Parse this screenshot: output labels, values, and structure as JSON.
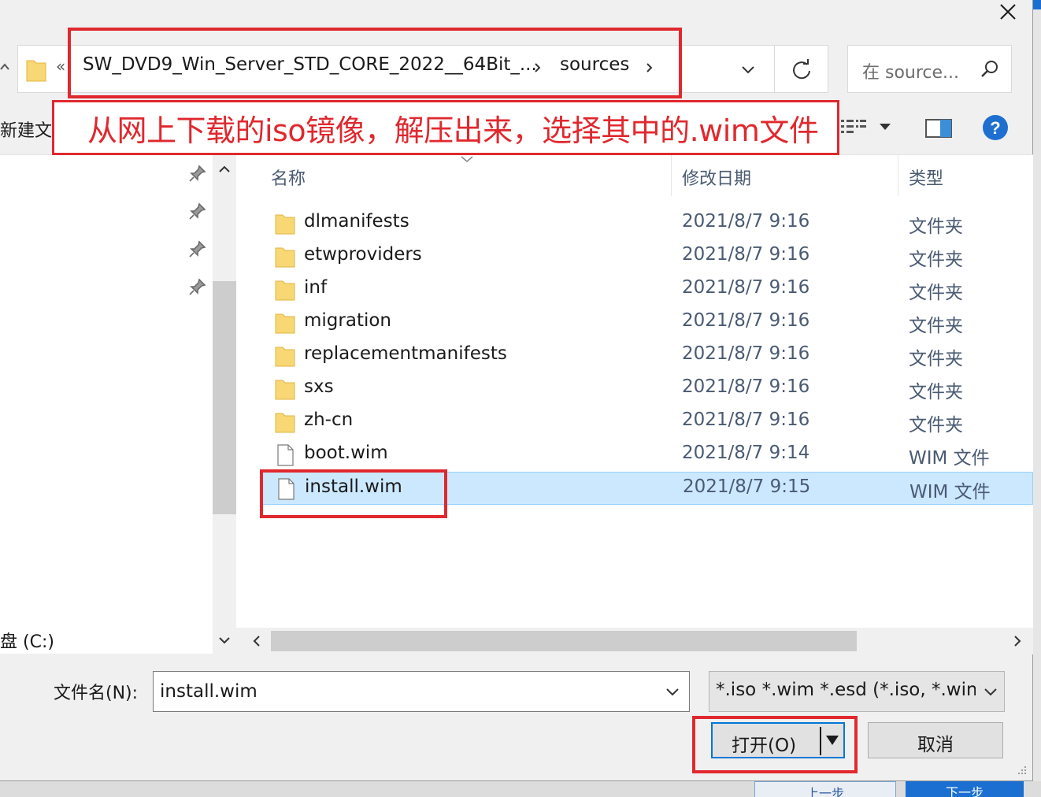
{
  "address_bar": {
    "overflow_label": "«",
    "segments": [
      "SW_DVD9_Win_Server_STD_CORE_2022__64Bit_...",
      "sources"
    ]
  },
  "search": {
    "placeholder": "在 source..."
  },
  "toolbar": {
    "new_folder_label": "新建文件夹"
  },
  "annotation": {
    "caption": "从网上下载的iso镜像，解压出来，选择其中的.wim文件"
  },
  "nav_pane": {
    "drive_label": "盘 (C:)"
  },
  "columns": {
    "name": "名称",
    "date_modified": "修改日期",
    "type": "类型"
  },
  "files": [
    {
      "name": "dlmanifests",
      "date": "2021/8/7 9:16",
      "type": "文件夹",
      "kind": "folder"
    },
    {
      "name": "etwproviders",
      "date": "2021/8/7 9:16",
      "type": "文件夹",
      "kind": "folder"
    },
    {
      "name": "inf",
      "date": "2021/8/7 9:16",
      "type": "文件夹",
      "kind": "folder"
    },
    {
      "name": "migration",
      "date": "2021/8/7 9:16",
      "type": "文件夹",
      "kind": "folder"
    },
    {
      "name": "replacementmanifests",
      "date": "2021/8/7 9:16",
      "type": "文件夹",
      "kind": "folder"
    },
    {
      "name": "sxs",
      "date": "2021/8/7 9:16",
      "type": "文件夹",
      "kind": "folder"
    },
    {
      "name": "zh-cn",
      "date": "2021/8/7 9:16",
      "type": "文件夹",
      "kind": "folder"
    },
    {
      "name": "boot.wim",
      "date": "2021/8/7 9:14",
      "type": "WIM 文件",
      "kind": "file"
    },
    {
      "name": "install.wim",
      "date": "2021/8/7 9:15",
      "type": "WIM 文件",
      "kind": "file",
      "selected": true
    }
  ],
  "bottom": {
    "filename_label": "文件名(N):",
    "filename_value": "install.wim",
    "filter_value": "*.iso *.wim *.esd (*.iso, *.wim",
    "open_label": "打开(O)",
    "cancel_label": "取消"
  },
  "parent_window": {
    "button1_label": "上一步",
    "button2_label": "下一步"
  },
  "colors": {
    "annotation_red": "#e0282e",
    "selection": "#cce8ff",
    "accent": "#0078d7"
  }
}
